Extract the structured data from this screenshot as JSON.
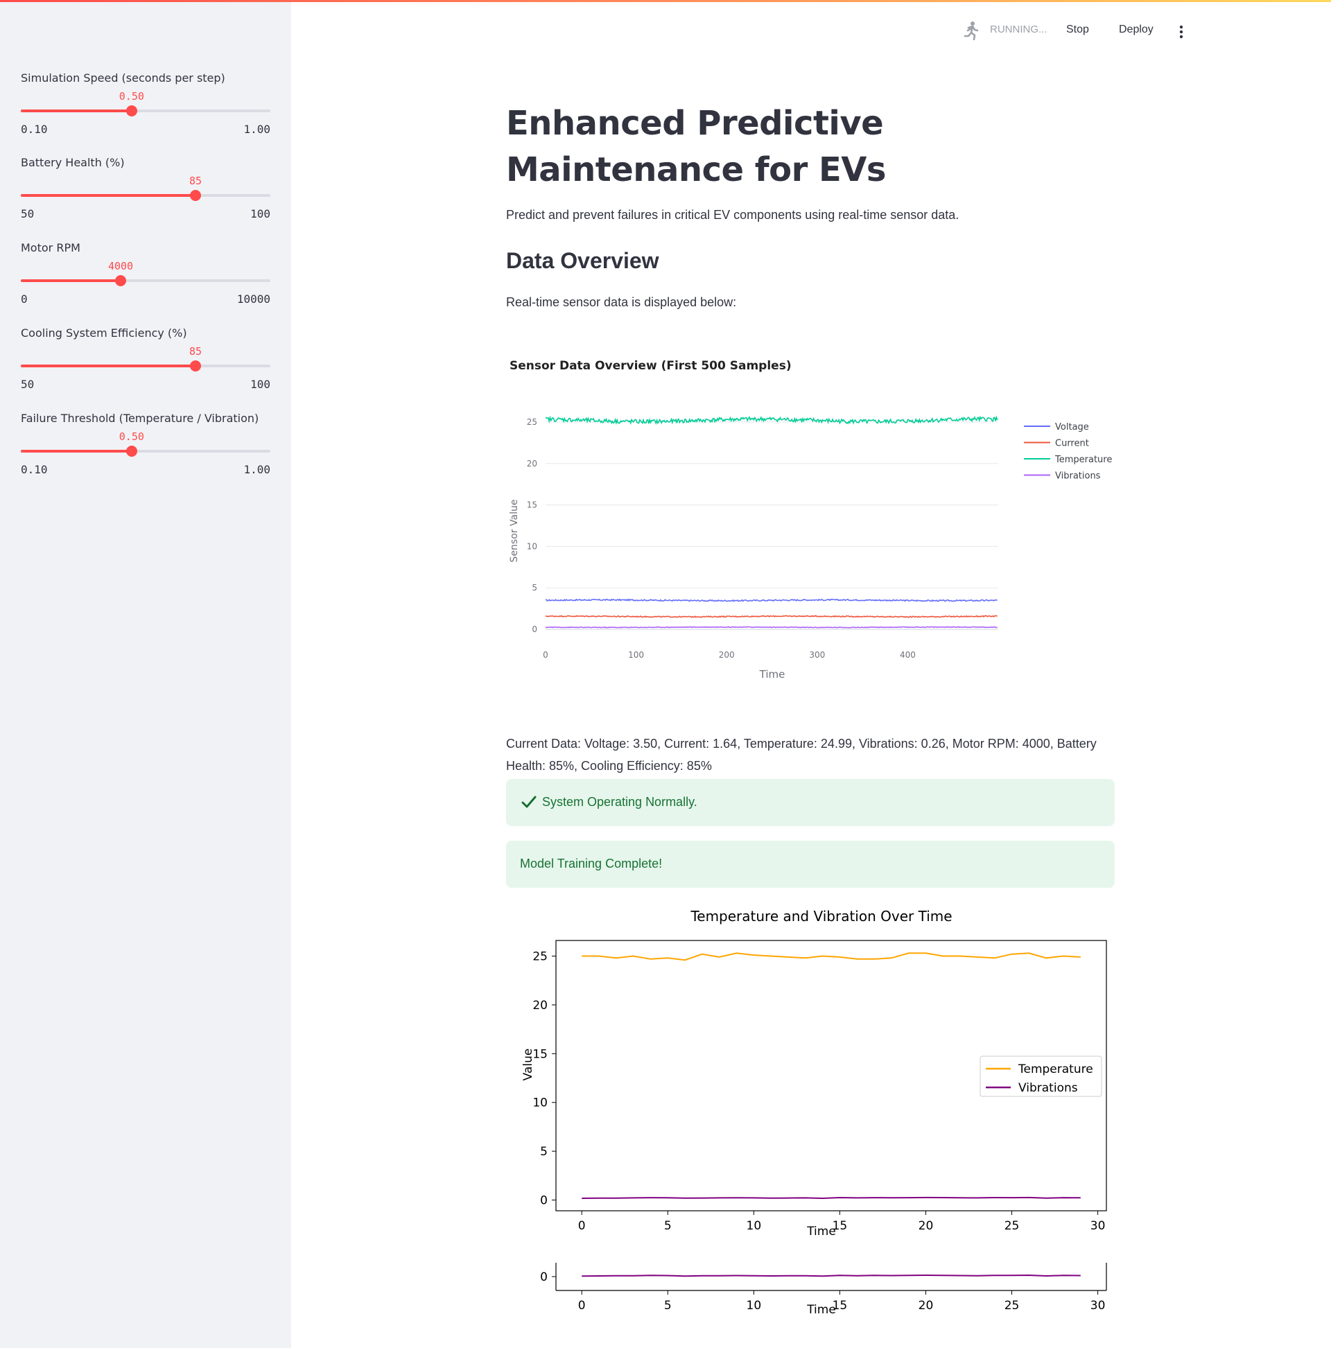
{
  "header": {
    "running_label": "RUNNING...",
    "stop_label": "Stop",
    "deploy_label": "Deploy"
  },
  "sidebar": {
    "sliders": [
      {
        "label": "Simulation Speed (seconds per step)",
        "value": "0.50",
        "min": "0.10",
        "max": "1.00",
        "fraction": 0.444
      },
      {
        "label": "Battery Health (%)",
        "value": "85",
        "min": "50",
        "max": "100",
        "fraction": 0.7
      },
      {
        "label": "Motor RPM",
        "value": "4000",
        "min": "0",
        "max": "10000",
        "fraction": 0.4
      },
      {
        "label": "Cooling System Efficiency (%)",
        "value": "85",
        "min": "50",
        "max": "100",
        "fraction": 0.7
      },
      {
        "label": "Failure Threshold (Temperature / Vibration)",
        "value": "0.50",
        "min": "0.10",
        "max": "1.00",
        "fraction": 0.444
      }
    ]
  },
  "main": {
    "title": "Enhanced Predictive Maintenance for EVs",
    "subtitle": "Predict and prevent failures in critical EV components using real-time sensor data.",
    "section_heading": "Data Overview",
    "section_text": "Real-time sensor data is displayed below:",
    "current_data": "Current Data: Voltage: 3.50, Current: 1.64, Temperature: 24.99, Vibrations: 0.26, Motor RPM: 4000, Battery Health: 85%, Cooling Efficiency: 85%",
    "status_message": "System Operating Normally.",
    "training_message": "Model Training Complete!"
  },
  "chart_data": [
    {
      "type": "line",
      "title": "Sensor Data Overview (First 500 Samples)",
      "xlabel": "Time",
      "ylabel": "Sensor Value",
      "xlim": [
        0,
        500
      ],
      "ylim": [
        -1,
        27
      ],
      "x_ticks": [
        0,
        100,
        200,
        300,
        400
      ],
      "y_ticks": [
        0,
        5,
        10,
        15,
        20,
        25
      ],
      "grid": true,
      "legend_position": "top-right",
      "series": [
        {
          "name": "Voltage",
          "color": "#636efa",
          "mean": 3.5,
          "noise": 0.08
        },
        {
          "name": "Current",
          "color": "#ef553b",
          "mean": 1.55,
          "noise": 0.06
        },
        {
          "name": "Temperature",
          "color": "#00cc96",
          "mean": 25.2,
          "noise": 0.25
        },
        {
          "name": "Vibrations",
          "color": "#ab63fa",
          "mean": 0.25,
          "noise": 0.04
        }
      ]
    },
    {
      "type": "line",
      "title": "Temperature and Vibration Over Time",
      "xlabel": "Time",
      "ylabel": "Value",
      "xlim": [
        -1.5,
        30.5
      ],
      "ylim": [
        -1.1,
        26.6
      ],
      "x_ticks": [
        0,
        5,
        10,
        15,
        20,
        25,
        30
      ],
      "y_ticks": [
        0,
        5,
        10,
        15,
        20,
        25
      ],
      "legend_position": "center-right",
      "x": [
        0,
        1,
        2,
        3,
        4,
        5,
        6,
        7,
        8,
        9,
        10,
        11,
        12,
        13,
        14,
        15,
        16,
        17,
        18,
        19,
        20,
        21,
        22,
        23,
        24,
        25,
        26,
        27,
        28,
        29
      ],
      "series": [
        {
          "name": "Temperature",
          "color": "#ffa500",
          "values": [
            25.0,
            25.0,
            24.8,
            25.0,
            24.7,
            24.8,
            24.6,
            25.2,
            24.9,
            25.3,
            25.1,
            25.0,
            24.9,
            24.8,
            25.0,
            24.9,
            24.7,
            24.7,
            24.8,
            25.3,
            25.3,
            25.0,
            25.0,
            24.9,
            24.8,
            25.2,
            25.3,
            24.8,
            25.0,
            24.9
          ]
        },
        {
          "name": "Vibrations",
          "color": "#800080",
          "values": [
            0.18,
            0.19,
            0.2,
            0.22,
            0.24,
            0.23,
            0.19,
            0.21,
            0.22,
            0.23,
            0.22,
            0.2,
            0.21,
            0.22,
            0.18,
            0.25,
            0.22,
            0.24,
            0.23,
            0.24,
            0.26,
            0.25,
            0.23,
            0.22,
            0.25,
            0.24,
            0.26,
            0.2,
            0.24,
            0.23
          ]
        }
      ]
    },
    {
      "type": "line",
      "xlabel": "Time",
      "xlim": [
        -1.5,
        30.5
      ],
      "ylim": [
        -1.2,
        1.2
      ],
      "x_ticks": [
        0,
        5,
        10,
        15,
        20,
        25,
        30
      ],
      "y_ticks": [
        0
      ],
      "x": [
        0,
        1,
        2,
        3,
        4,
        5,
        6,
        7,
        8,
        9,
        10,
        11,
        12,
        13,
        14,
        15,
        16,
        17,
        18,
        19,
        20,
        21,
        22,
        23,
        24,
        25,
        26,
        27,
        28,
        29
      ],
      "series": [
        {
          "name": "Vibrations",
          "color": "#800080",
          "values": [
            0.05,
            0.06,
            0.07,
            0.08,
            0.1,
            0.09,
            0.05,
            0.07,
            0.08,
            0.09,
            0.08,
            0.06,
            0.07,
            0.08,
            0.04,
            0.11,
            0.08,
            0.1,
            0.09,
            0.1,
            0.12,
            0.11,
            0.09,
            0.08,
            0.11,
            0.1,
            0.12,
            0.06,
            0.1,
            0.09
          ]
        }
      ]
    }
  ]
}
